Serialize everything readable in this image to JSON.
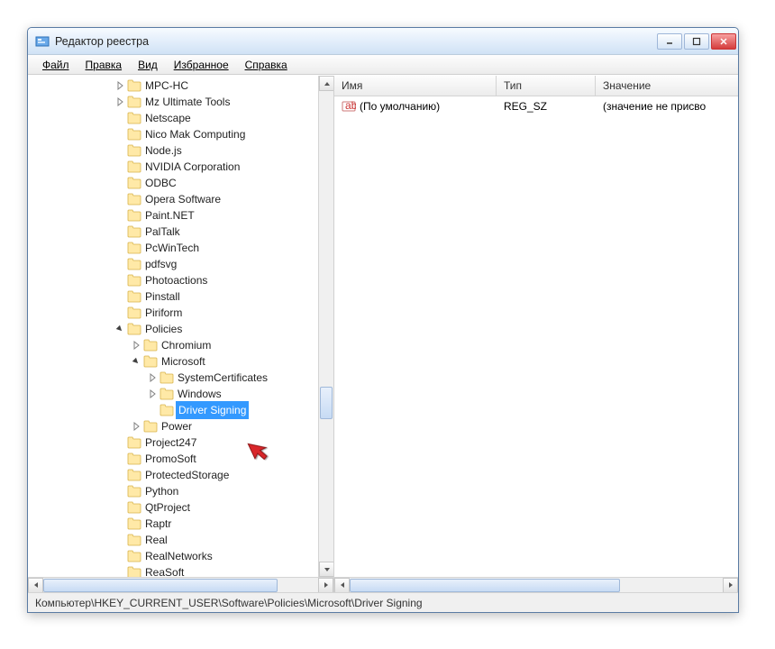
{
  "window": {
    "title": "Редактор реестра"
  },
  "menu": {
    "file": "Файл",
    "edit": "Правка",
    "view": "Вид",
    "favorites": "Избранное",
    "help": "Справка"
  },
  "tree": {
    "items": [
      {
        "indent": 0,
        "exp": "collapsed",
        "label": "MPC-HC"
      },
      {
        "indent": 0,
        "exp": "collapsed",
        "label": "Mz Ultimate Tools"
      },
      {
        "indent": 0,
        "exp": "none",
        "label": "Netscape"
      },
      {
        "indent": 0,
        "exp": "none",
        "label": "Nico Mak Computing"
      },
      {
        "indent": 0,
        "exp": "none",
        "label": "Node.js"
      },
      {
        "indent": 0,
        "exp": "none",
        "label": "NVIDIA Corporation"
      },
      {
        "indent": 0,
        "exp": "none",
        "label": "ODBC"
      },
      {
        "indent": 0,
        "exp": "none",
        "label": "Opera Software"
      },
      {
        "indent": 0,
        "exp": "none",
        "label": "Paint.NET"
      },
      {
        "indent": 0,
        "exp": "none",
        "label": "PalTalk"
      },
      {
        "indent": 0,
        "exp": "none",
        "label": "PcWinTech"
      },
      {
        "indent": 0,
        "exp": "none",
        "label": "pdfsvg"
      },
      {
        "indent": 0,
        "exp": "none",
        "label": "Photoactions"
      },
      {
        "indent": 0,
        "exp": "none",
        "label": "Pinstall"
      },
      {
        "indent": 0,
        "exp": "none",
        "label": "Piriform"
      },
      {
        "indent": 0,
        "exp": "expanded",
        "label": "Policies"
      },
      {
        "indent": 1,
        "exp": "collapsed",
        "label": "Chromium"
      },
      {
        "indent": 1,
        "exp": "expanded",
        "label": "Microsoft"
      },
      {
        "indent": 2,
        "exp": "collapsed",
        "label": "SystemCertificates"
      },
      {
        "indent": 2,
        "exp": "collapsed",
        "label": "Windows"
      },
      {
        "indent": 2,
        "exp": "none",
        "label": "Driver Signing",
        "editing": true
      },
      {
        "indent": 1,
        "exp": "collapsed",
        "label": "Power"
      },
      {
        "indent": 0,
        "exp": "none",
        "label": "Project247"
      },
      {
        "indent": 0,
        "exp": "none",
        "label": "PromoSoft"
      },
      {
        "indent": 0,
        "exp": "none",
        "label": "ProtectedStorage"
      },
      {
        "indent": 0,
        "exp": "none",
        "label": "Python"
      },
      {
        "indent": 0,
        "exp": "none",
        "label": "QtProject"
      },
      {
        "indent": 0,
        "exp": "none",
        "label": "Raptr"
      },
      {
        "indent": 0,
        "exp": "none",
        "label": "Real"
      },
      {
        "indent": 0,
        "exp": "none",
        "label": "RealNetworks"
      },
      {
        "indent": 0,
        "exp": "none",
        "label": "ReaSoft"
      }
    ]
  },
  "list": {
    "columns": {
      "name": "Имя",
      "type": "Тип",
      "value": "Значение"
    },
    "rows": [
      {
        "name": "(По умолчанию)",
        "type": "REG_SZ",
        "value": "(значение не присво"
      }
    ]
  },
  "statusbar": {
    "path": "Компьютер\\HKEY_CURRENT_USER\\Software\\Policies\\Microsoft\\Driver Signing"
  }
}
